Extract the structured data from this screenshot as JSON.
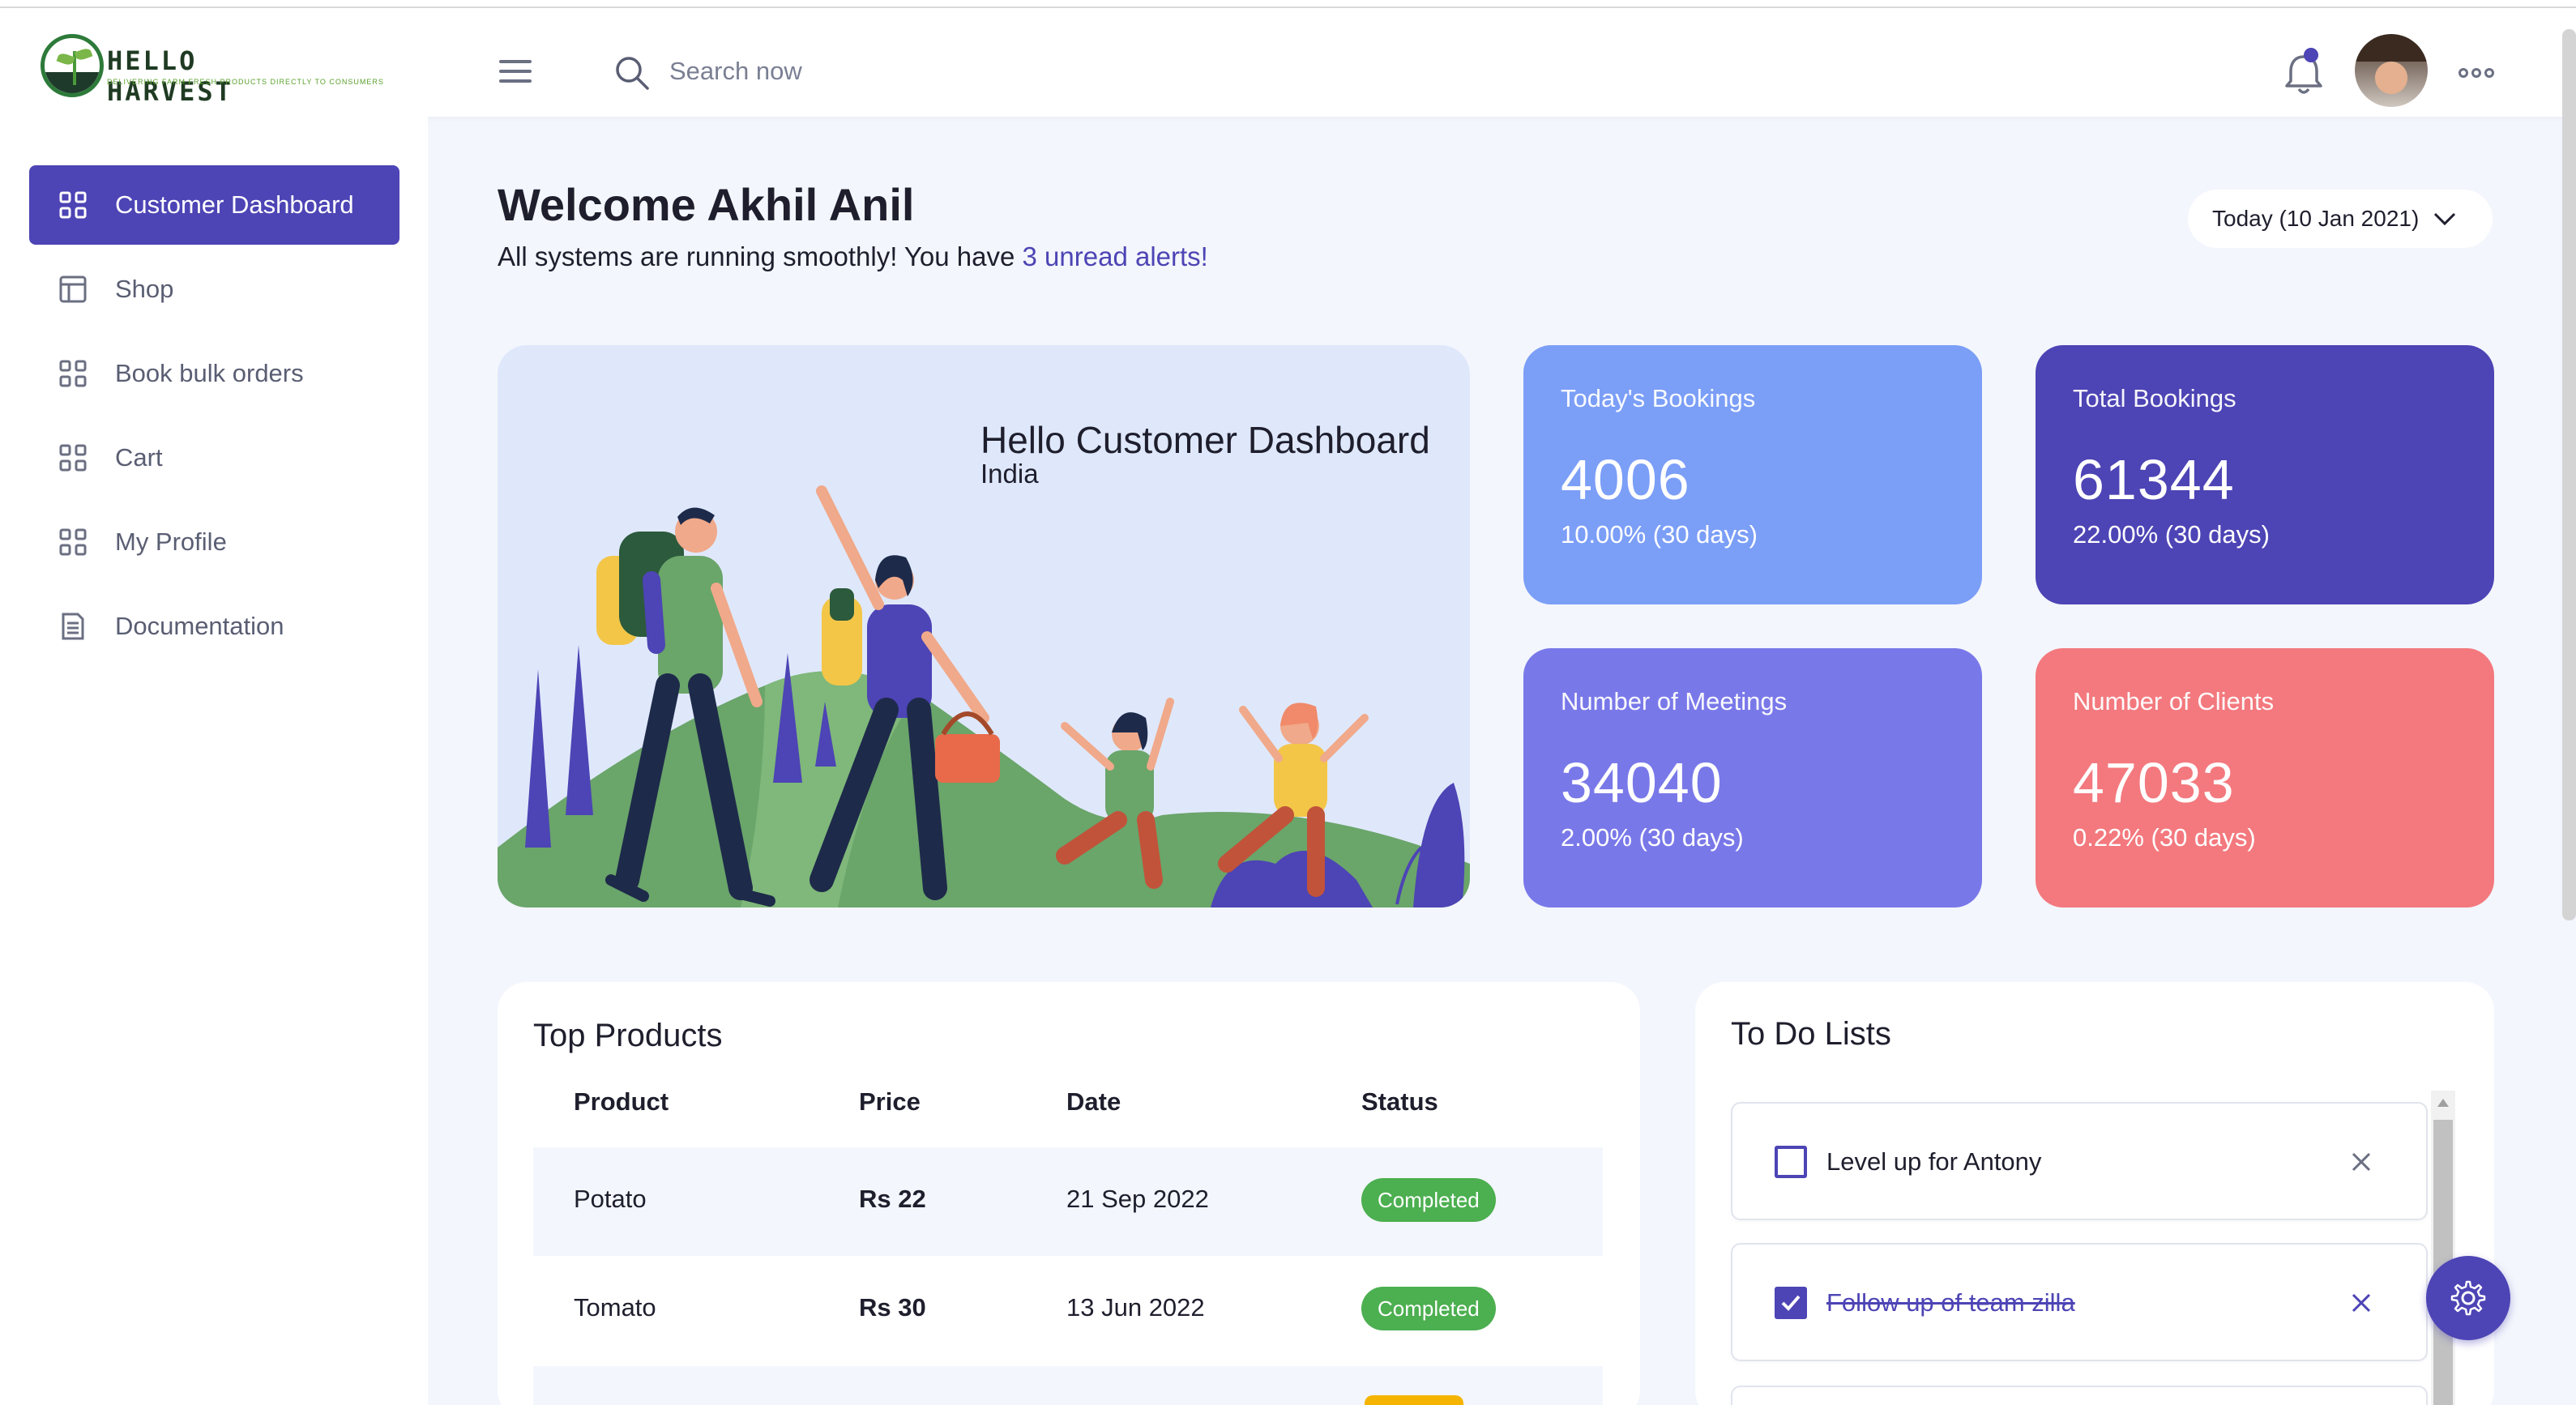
{
  "header": {
    "logo_title": "HELLO HARVEST",
    "logo_tagline": "DELIVERING FARM FRESH PRODUCTS DIRECTLY TO CONSUMERS",
    "search_placeholder": "Search now"
  },
  "sidebar": {
    "items": [
      {
        "label": "Customer Dashboard",
        "icon": "grid-icon",
        "active": true
      },
      {
        "label": "Shop",
        "icon": "layout-icon",
        "active": false
      },
      {
        "label": "Book bulk orders",
        "icon": "grid-icon",
        "active": false
      },
      {
        "label": "Cart",
        "icon": "grid-icon",
        "active": false
      },
      {
        "label": "My Profile",
        "icon": "grid-icon",
        "active": false
      },
      {
        "label": "Documentation",
        "icon": "document-icon",
        "active": false
      }
    ]
  },
  "welcome": {
    "title": "Welcome Akhil Anil",
    "subtitle_prefix": "All systems are running smoothly! You have ",
    "alerts_link": "3 unread alerts!",
    "date_filter": "Today (10 Jan 2021)"
  },
  "hero": {
    "title": "Hello Customer Dashboard",
    "subtitle": "India"
  },
  "stats": [
    {
      "label": "Today's Bookings",
      "value": "4006",
      "change": "10.00% (30 days)",
      "color": "#7b9ef7"
    },
    {
      "label": "Total Bookings",
      "value": "61344",
      "change": "22.00% (30 days)",
      "color": "#4d44b5"
    },
    {
      "label": "Number of Meetings",
      "value": "34040",
      "change": "2.00% (30 days)",
      "color": "#7978e9"
    },
    {
      "label": "Number of Clients",
      "value": "47033",
      "change": "0.22% (30 days)",
      "color": "#f3797e"
    }
  ],
  "top_products": {
    "title": "Top Products",
    "columns": [
      "Product",
      "Price",
      "Date",
      "Status"
    ],
    "rows": [
      {
        "product": "Potato",
        "price": "Rs 22",
        "date": "21 Sep 2022",
        "status": "Completed"
      },
      {
        "product": "Tomato",
        "price": "Rs 30",
        "date": "13 Jun 2022",
        "status": "Completed"
      }
    ]
  },
  "todo": {
    "title": "To Do Lists",
    "items": [
      {
        "text": "Level up for Antony",
        "done": false
      },
      {
        "text": "Follow up of team zilla",
        "done": true
      }
    ]
  },
  "colors": {
    "accent": "#4d44b5",
    "success": "#4caf50",
    "background": "#f3f6fc"
  }
}
